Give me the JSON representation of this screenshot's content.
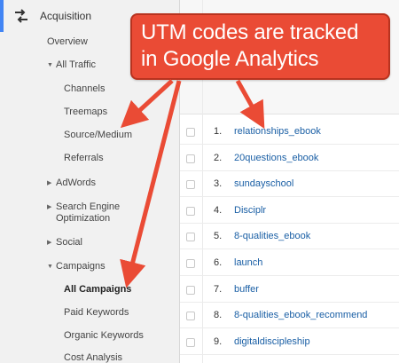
{
  "sidebar": {
    "header": {
      "label": "Acquisition",
      "icon": "acquisition-arrows-icon"
    },
    "overview": "Overview",
    "all_traffic": {
      "label": "All Traffic",
      "expanded": true,
      "items": [
        "Channels",
        "Treemaps",
        "Source/Medium",
        "Referrals"
      ]
    },
    "adwords": {
      "label": "AdWords",
      "expanded": false
    },
    "seo": {
      "label_line1": "Search Engine",
      "label_line2": "Optimization",
      "expanded": false
    },
    "social": {
      "label": "Social",
      "expanded": false
    },
    "campaigns": {
      "label": "Campaigns",
      "expanded": true,
      "items": [
        "All Campaigns",
        "Paid Keywords",
        "Organic Keywords",
        "Cost Analysis"
      ],
      "selected": "All Campaigns"
    }
  },
  "table": {
    "rows": [
      {
        "num": "1.",
        "campaign": "relationships_ebook"
      },
      {
        "num": "2.",
        "campaign": "20questions_ebook"
      },
      {
        "num": "3.",
        "campaign": "sundayschool"
      },
      {
        "num": "4.",
        "campaign": "Disciplr"
      },
      {
        "num": "5.",
        "campaign": "8-qualities_ebook"
      },
      {
        "num": "6.",
        "campaign": "launch"
      },
      {
        "num": "7.",
        "campaign": "buffer"
      },
      {
        "num": "8.",
        "campaign": "8-qualities_ebook_recommend"
      },
      {
        "num": "9.",
        "campaign": "digitaldiscipleship"
      }
    ]
  },
  "callout": {
    "line1": "UTM codes are tracked",
    "line2": "in Google Analytics"
  },
  "colors": {
    "callout": "#ea4b35",
    "link": "#1a5fa5",
    "accent": "#4285f4"
  }
}
